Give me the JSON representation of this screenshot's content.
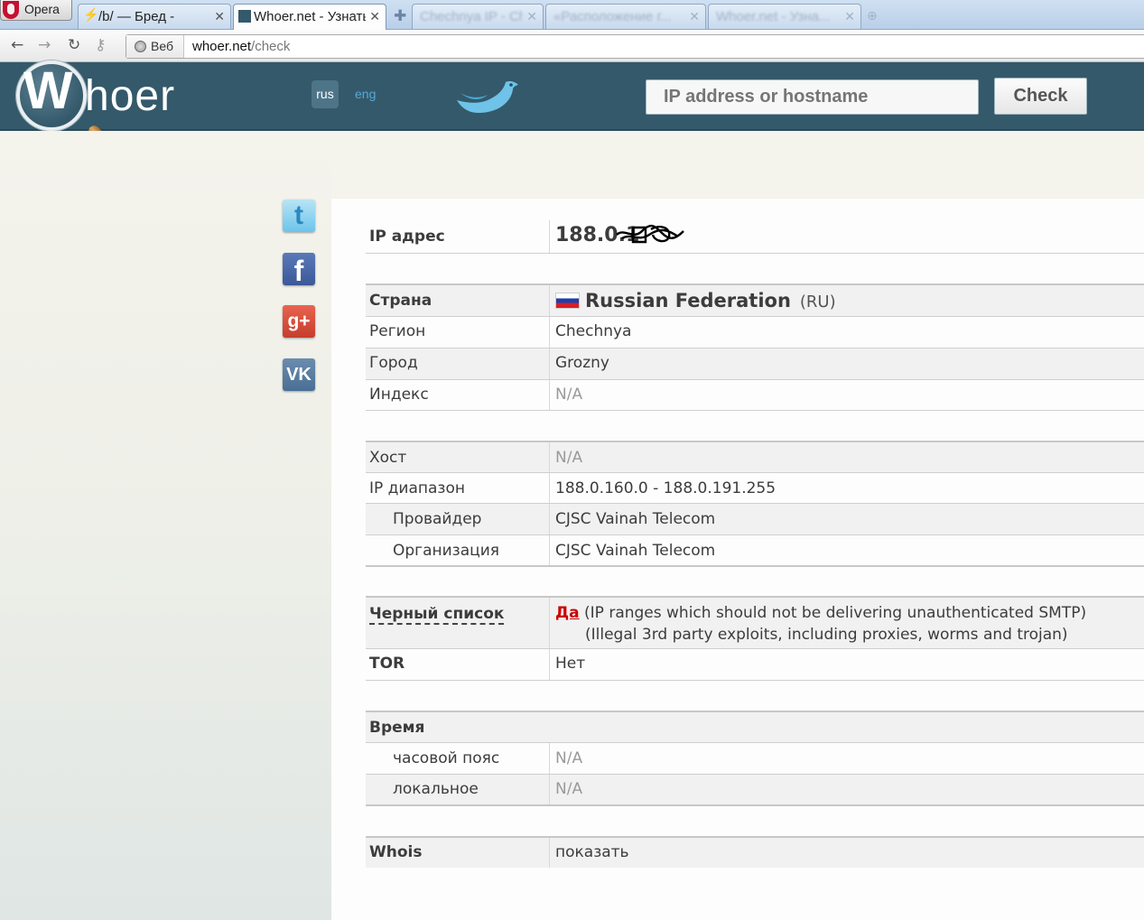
{
  "browser": {
    "opera_label": "Opera",
    "tabs": [
      {
        "label": "/b/ — Бред -",
        "active": false
      },
      {
        "label": "Whoer.net - Узнать",
        "active": true
      },
      {
        "label": "Chechnya IP - Ch...",
        "active": false
      },
      {
        "label": "«Расположение г...",
        "active": false
      },
      {
        "label": "Whoer.net - Узна...",
        "active": false
      }
    ],
    "address_prefix": "Веб",
    "url_host": "whoer.net",
    "url_path": "/check"
  },
  "header": {
    "logo_first": "W",
    "logo_rest": "hoer",
    "lang_rus": "rus",
    "lang_eng": "eng",
    "search_placeholder": "IP address or hostname",
    "check_label": "Check"
  },
  "social": {
    "twitter": "t",
    "facebook": "f",
    "google": "g+",
    "vk": "VK"
  },
  "info": {
    "ip_label": "IP адрес",
    "ip_value": "188.0.1",
    "country_label": "Страна",
    "country_value": "Russian Federation",
    "country_code": "(RU)",
    "region_label": "Регион",
    "region_value": "Chechnya",
    "city_label": "Город",
    "city_value": "Grozny",
    "index_label": "Индекс",
    "index_value": "N/A",
    "host_label": "Хост",
    "host_value": "N/A",
    "range_label": "IP диапазон",
    "range_value": "188.0.160.0 - 188.0.191.255",
    "provider_label": "Провайдер",
    "provider_value": "CJSC Vainah Telecom",
    "org_label": "Организация",
    "org_value": "CJSC Vainah Telecom",
    "blacklist_label": "Черный список",
    "blacklist_yes": "Да",
    "blacklist_line1": "(IP ranges which should not be delivering unauthenticated SMTP)",
    "blacklist_line2": "(Illegal 3rd party exploits, including proxies, worms and trojan)",
    "tor_label": "TOR",
    "tor_value": "Нет",
    "time_label": "Время",
    "tz_label": "часовой пояс",
    "tz_value": "N/A",
    "local_label": "локальное",
    "local_value": "N/A",
    "whois_label": "Whois",
    "whois_link": "показать"
  }
}
